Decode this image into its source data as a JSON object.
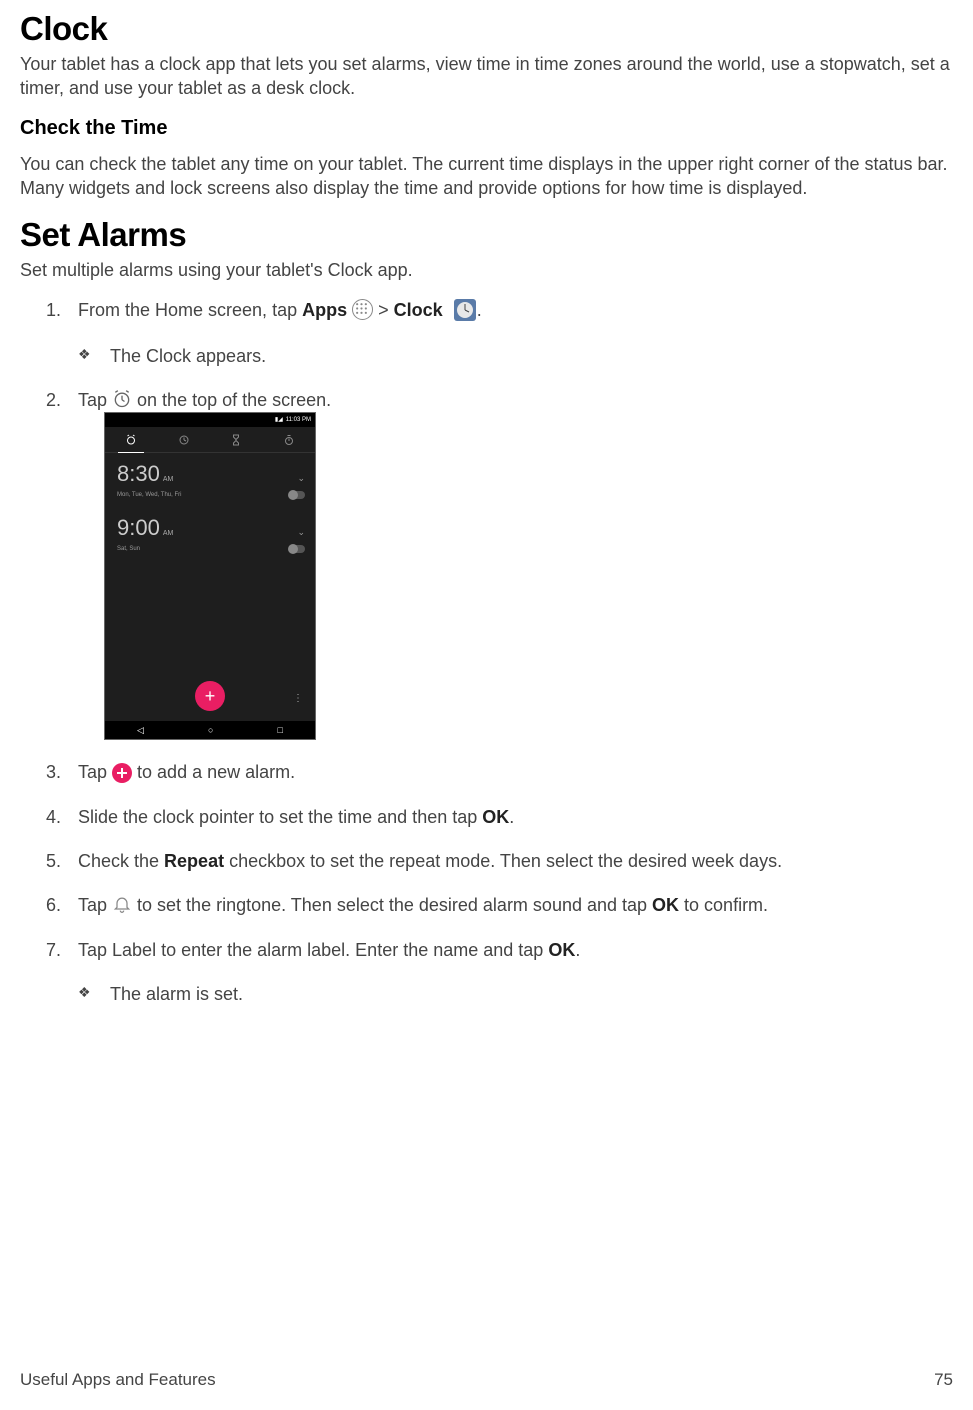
{
  "h1_clock": "Clock",
  "clock_intro": "Your tablet has a clock app that lets you set alarms, view time in time zones around the world, use a stopwatch, set a timer, and use your tablet as a desk clock.",
  "h2_check": "Check the Time",
  "check_body": "You can check the tablet any time on your tablet. The current time displays in the upper right corner of the status bar. Many widgets and lock screens also display the time and provide options for how time is displayed.",
  "h1_alarms": "Set Alarms",
  "alarms_intro": "Set multiple alarms using your tablet's Clock app.",
  "steps": {
    "s1a": "From the Home screen, tap ",
    "s1_apps": "Apps",
    "s1b": " > ",
    "s1_clock": "Clock",
    "s1c": ".",
    "s1_sub": "The Clock appears.",
    "s2a": "Tap ",
    "s2b": " on the top of the screen.",
    "s3a": "Tap ",
    "s3b": " to add a new alarm.",
    "s4a": "Slide the clock pointer to set the time and then tap ",
    "s4_ok": "OK",
    "s4b": ".",
    "s5a": "Check the ",
    "s5_repeat": "Repeat",
    "s5b": " checkbox to set the repeat mode. Then select the desired week days.",
    "s6a": "Tap ",
    "s6b": " to set the ringtone. Then select the desired alarm sound and tap ",
    "s6_ok": "OK",
    "s6c": " to confirm.",
    "s7a": "Tap Label to enter the alarm label. Enter the name and tap ",
    "s7_ok": "OK",
    "s7b": ".",
    "s7_sub": "The alarm is set."
  },
  "screenshot": {
    "status_time": "11:03 PM",
    "alarm1": {
      "time": "8:30",
      "ampm": "AM",
      "days": "Mon, Tue, Wed, Thu, Fri"
    },
    "alarm2": {
      "time": "9:00",
      "ampm": "AM",
      "days": "Sat, Sun"
    },
    "fab": "+",
    "nav_back": "◁",
    "nav_home": "○",
    "nav_recent": "□"
  },
  "footer_left": "Useful Apps and Features",
  "footer_right": "75"
}
